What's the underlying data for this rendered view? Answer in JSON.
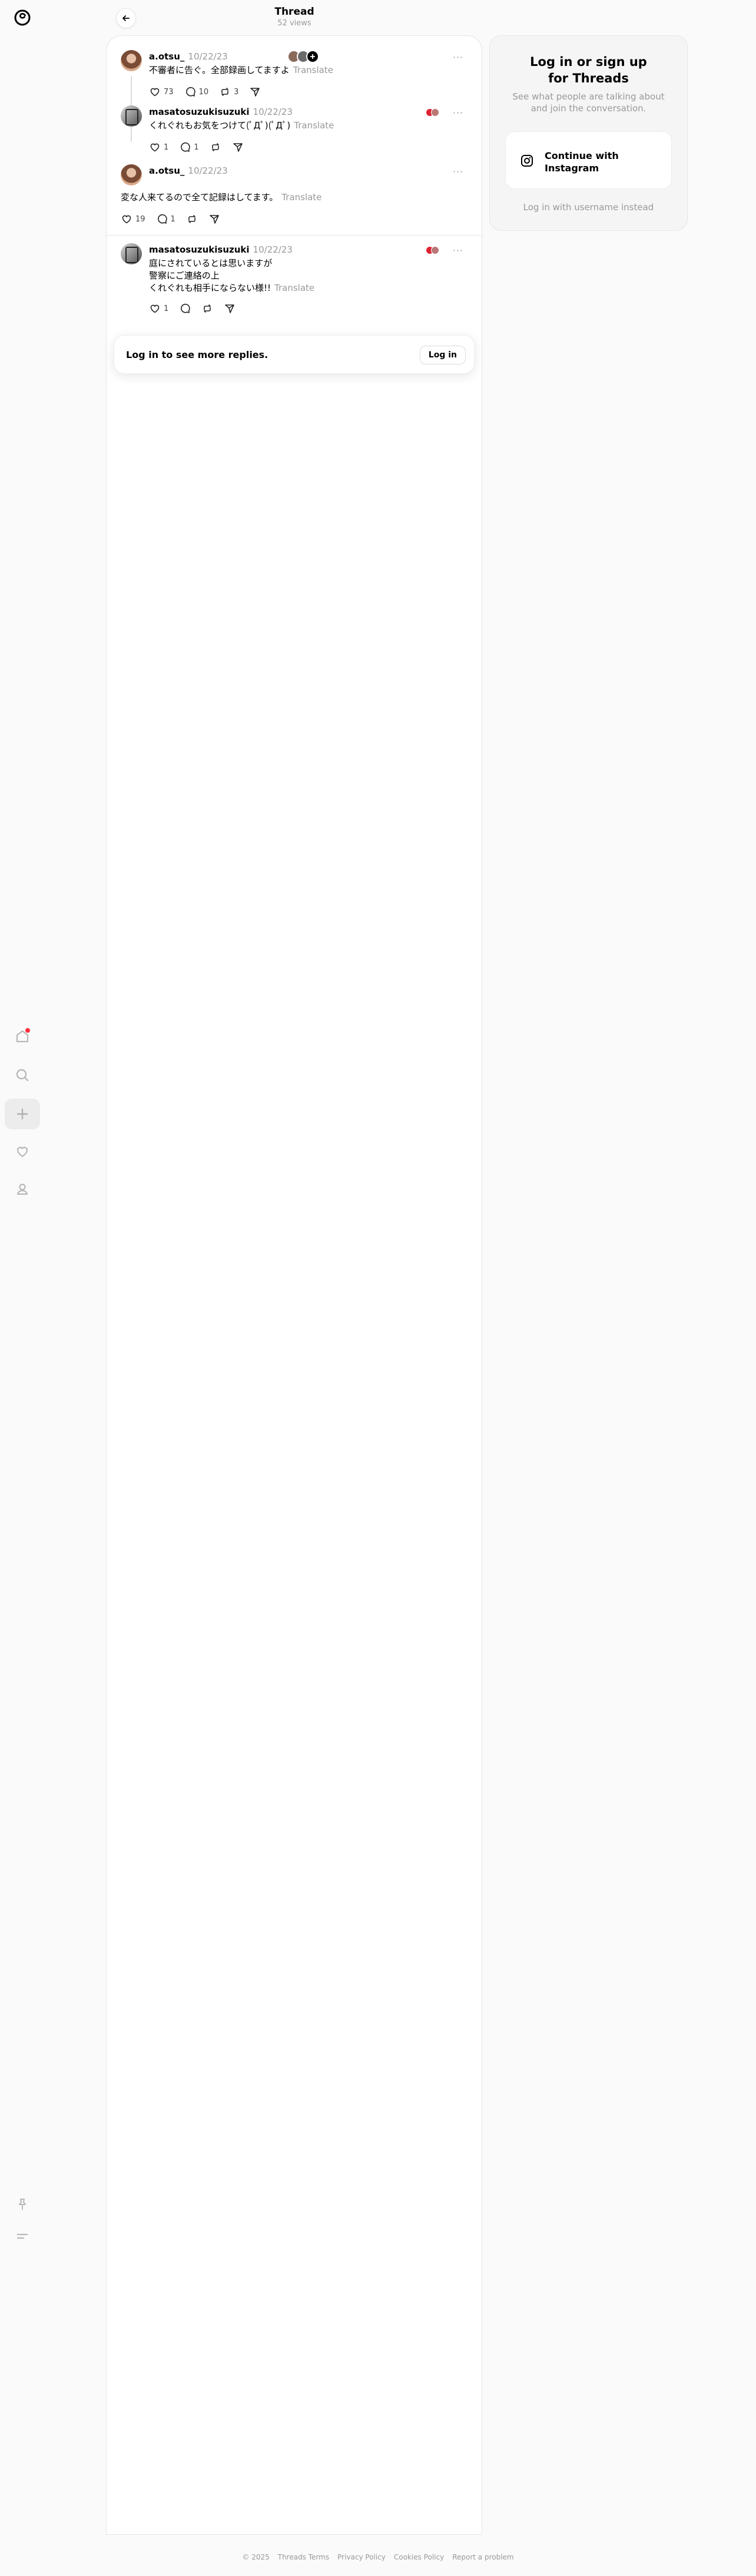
{
  "header": {
    "title": "Thread",
    "views": "52 views"
  },
  "posts": [
    {
      "username": "a.otsu_",
      "date": "10/22/23",
      "text": "不審者に告ぐ。全部録画してますよ",
      "translate": "Translate",
      "likes": "73",
      "replies": "10",
      "reposts": "3"
    },
    {
      "username": "masatosuzukisuzuki",
      "date": "10/22/23",
      "text": "くれぐれもお気をつけて(ﾟДﾟ)(ﾟДﾟ)",
      "translate": "Translate",
      "likes": "1",
      "replies": "1",
      "reposts": ""
    },
    {
      "username": "a.otsu_",
      "date": "10/22/23",
      "text": "変な人来てるので全て記録はしてます。",
      "translate": "Translate",
      "likes": "19",
      "replies": "1",
      "reposts": ""
    },
    {
      "username": "masatosuzukisuzuki",
      "date": "10/22/23",
      "text_lines": [
        "庭にされているとは思いますが",
        "警察にご連絡の上",
        "くれぐれも相手にならない様!!"
      ],
      "translate": "Translate",
      "likes": "1",
      "replies": "",
      "reposts": ""
    }
  ],
  "login_bar": {
    "text": "Log in to see more replies.",
    "button": "Log in"
  },
  "side": {
    "title_line1": "Log in or sign up",
    "title_line2": "for Threads",
    "subtitle_line1": "See what people are talking about",
    "subtitle_line2": "and join the conversation.",
    "instagram_line1": "Continue with",
    "instagram_line2": "Instagram",
    "alt_login": "Log in with username instead"
  },
  "footer": [
    "© 2025",
    "Threads Terms",
    "Privacy Policy",
    "Cookies Policy",
    "Report a problem"
  ],
  "icons": [
    "threads-logo-icon",
    "home-icon",
    "search-icon",
    "create-icon",
    "heart-icon",
    "profile-icon",
    "pin-icon",
    "menu-icon",
    "back-arrow-icon",
    "more-icon",
    "like-icon",
    "comment-icon",
    "repost-icon",
    "share-icon",
    "instagram-icon"
  ],
  "colors": {
    "notification": "#ff3040",
    "muted": "#999999",
    "background": "#fafafa"
  }
}
